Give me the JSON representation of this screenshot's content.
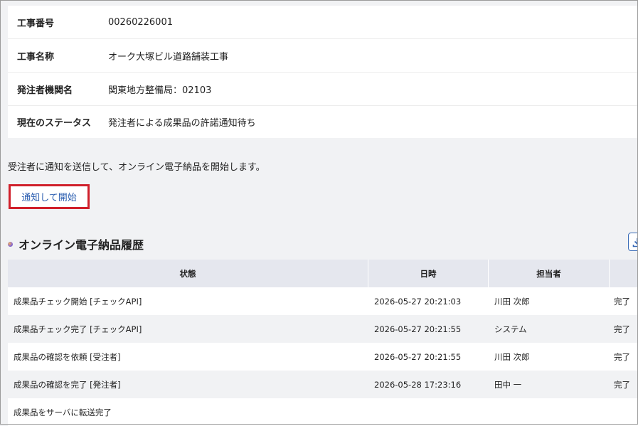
{
  "info": [
    {
      "label": "工事番号",
      "value": "00260226001"
    },
    {
      "label": "工事名称",
      "value": "オーク大塚ビル道路舗装工事"
    },
    {
      "label": "発注者機関名",
      "value": "関東地方整備局：02103"
    },
    {
      "label": "現在のステータス",
      "value": "発注者による成果品の許諾通知待ち"
    }
  ],
  "description": "受注者に通知を送信して、オンライン電子納品を開始します。",
  "notify_button": "通知して開始",
  "history": {
    "title": "オンライン電子納品履歴",
    "download_icon": "download-icon",
    "headers": [
      "状態",
      "日時",
      "担当者",
      ""
    ],
    "rows": [
      {
        "status": "成果品チェック開始 [チェックAPI]",
        "datetime": "2026-05-27 20:21:03",
        "person": "川田 次郎",
        "result": "完了"
      },
      {
        "status": "成果品チェック完了 [チェックAPI]",
        "datetime": "2026-05-27 20:21:55",
        "person": "システム",
        "result": "完了"
      },
      {
        "status": "成果品の確認を依頼 [受注者]",
        "datetime": "2026-05-27 20:21:55",
        "person": "川田 次郎",
        "result": "完了"
      },
      {
        "status": "成果品の確認を完了 [発注者]",
        "datetime": "2026-05-28 17:23:16",
        "person": "田中 一",
        "result": "完了"
      },
      {
        "status": "成果品をサーバに転送完了",
        "datetime": "",
        "person": "",
        "result": ""
      }
    ]
  }
}
